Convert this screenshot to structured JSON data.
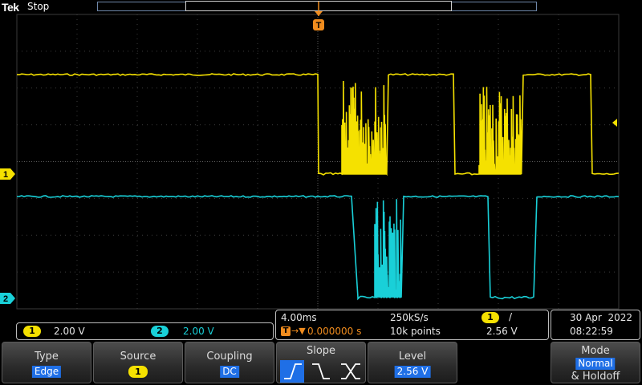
{
  "header": {
    "brand": "Tek",
    "status": "Stop"
  },
  "markers": {
    "trigger_position": "T",
    "ch1_ground": "1",
    "ch2_ground": "2"
  },
  "channels": [
    {
      "number": "1",
      "scale": "2.00 V",
      "color": "#f5e100"
    },
    {
      "number": "2",
      "scale": "2.00 V",
      "color": "#19d0d8"
    }
  ],
  "timebase": {
    "horizontal_scale": "4.00ms",
    "sample_rate": "250kS/s",
    "record_length": "10k points",
    "delay": "0.000000 s",
    "trigger_source": "1",
    "trigger_slope_symbol": "/",
    "trigger_level": "2.56 V"
  },
  "datetime": {
    "date": "30 Apr  2022",
    "time": "08:22:59"
  },
  "menu": {
    "type": {
      "title": "Type",
      "value": "Edge"
    },
    "source": {
      "title": "Source",
      "value": "1"
    },
    "coupling": {
      "title": "Coupling",
      "value": "DC"
    },
    "slope": {
      "title": "Slope"
    },
    "level": {
      "title": "Level",
      "value": "2.56 V"
    },
    "mode": {
      "title": "Mode",
      "value": "Normal",
      "suffix": "& Holdoff"
    }
  },
  "colors": {
    "ch1": "#f5e100",
    "ch2": "#19d0d8",
    "trigger": "#f08c1e",
    "accent_blue": "#1f6fe6"
  }
}
